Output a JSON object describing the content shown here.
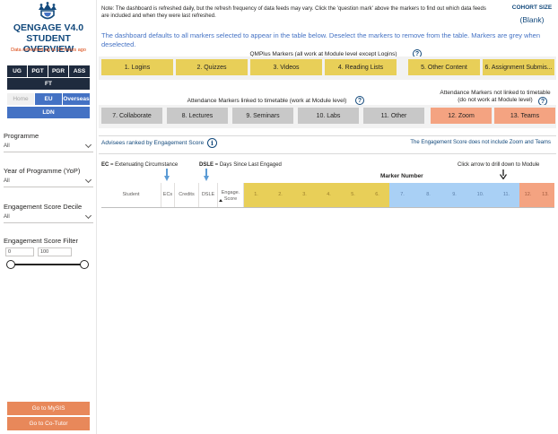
{
  "sidebar": {
    "title_line1": "QENGAGE V4.0",
    "title_line2": "STUDENT OVERVIEW",
    "refresh_note": "Data refreshed up to 24 hours ago",
    "level_buttons": [
      "UG",
      "PGT",
      "PGR",
      "ASS"
    ],
    "ft_button": "FT",
    "location_buttons": [
      "Home",
      "EU",
      "Overseas"
    ],
    "ldn_button": "LDN",
    "filters": [
      {
        "label": "Programme",
        "value": "All"
      },
      {
        "label": "Year of Programme (YoP)",
        "value": "All"
      },
      {
        "label": "Engagement Score Decile",
        "value": "All"
      }
    ],
    "score_filter": {
      "label": "Engagement Score Filter",
      "min": "0",
      "max": "100"
    },
    "buttons": {
      "mysis": "Go to MySIS",
      "cotutor": "Go to Co-Tutor"
    }
  },
  "main": {
    "note": "Note: The dashboard is refreshed daily, but the refresh frequency of data feeds may vary.  Click the 'question mark' above the markers to find out which data feeds are included and when they were last refreshed.",
    "cohort": {
      "label": "COHORT SIZE",
      "value": "(Blank)"
    },
    "instructions": "The dashboard defaults to all markers selected to appear in the table below.  Deselect the markers to remove from the table.  Markers are grey when deselected.",
    "qmplus": {
      "title": "QMPlus Markers (all work at Module level except Logins)",
      "markers": [
        "1. Logins",
        "2. Quizzes",
        "3. Videos",
        "4. Reading Lists",
        "5. Other Content",
        "6. Assignment Submis..."
      ]
    },
    "attendance_linked": {
      "title": "Attendance Markers linked to timetable (work at Module level)",
      "markers": [
        "7. Collaborate",
        "8. Lectures",
        "9. Seminars",
        "10. Labs",
        "11. Other"
      ]
    },
    "attendance_not_linked": {
      "title_line1": "Attendance Markers not linked to timetable",
      "title_line2": "(do not work at Module level)",
      "markers": [
        "12. Zoom",
        "13. Teams"
      ]
    },
    "advisees_label": "Advisees ranked by Engagement Score",
    "engagement_note": "The Engagement Score does not include Zoom and Teams",
    "ec_def": {
      "abbr": "EC",
      "text": " = Extenuating Circumstance"
    },
    "dsle_def": {
      "abbr": "DSLE",
      "text": " = Days Since Last Engaged"
    },
    "drill_note": "Click arrow to drill down to Module",
    "marker_number_label": "Marker Number",
    "table": {
      "headers": [
        "Student",
        "ECs",
        "Credits",
        "DSLE",
        "Engage. Score"
      ],
      "marker_cols": [
        "1.",
        "2.",
        "3.",
        "4.",
        "5.",
        "6.",
        "7.",
        "8.",
        "9.",
        "10.",
        "11.",
        "12.",
        "13."
      ]
    }
  },
  "colors": {
    "title_blue": "#12497c",
    "link_blue": "#4472c4",
    "dark_navy": "#1f2b3e",
    "marker_yellow": "#e8cf58",
    "marker_grey": "#c8c8c8",
    "marker_salmon": "#f4a381",
    "marker_blue": "#a9d0f5",
    "button_orange": "#e8885a",
    "warning_red": "#d83b01"
  },
  "icons": [
    "crown-logo-icon",
    "question-mark-icon",
    "info-icon",
    "chevron-down-icon",
    "down-arrow-icon",
    "sort-ascending-icon"
  ]
}
